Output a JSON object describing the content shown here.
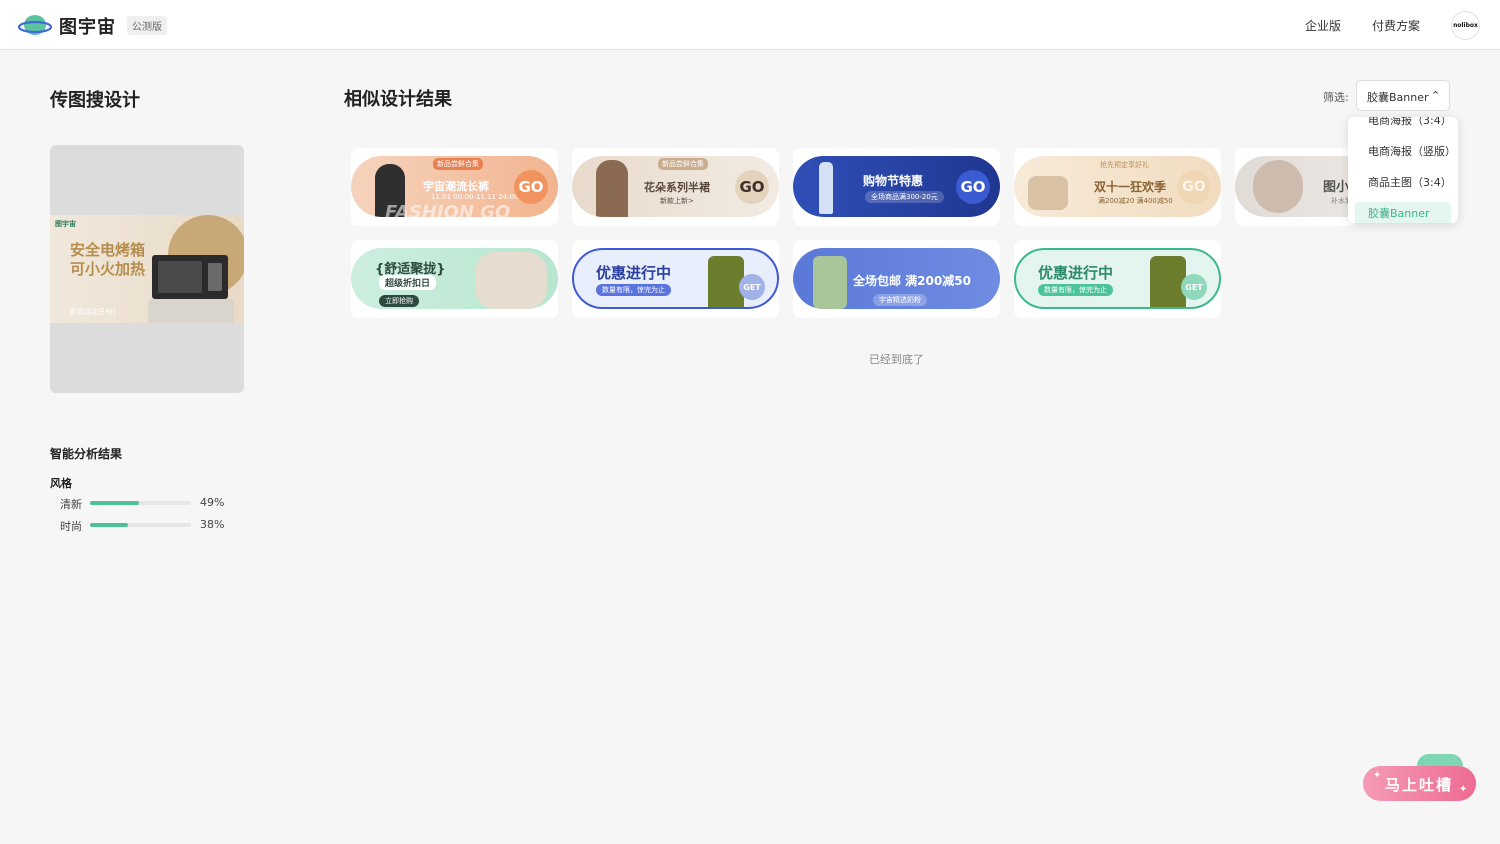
{
  "header": {
    "brand": "图宇宙",
    "beta_badge": "公测版",
    "nav": [
      "企业版",
      "付费方案"
    ],
    "avatar_text": "nolibox"
  },
  "left": {
    "title": "传图搜设计",
    "upload_preview": {
      "logo_text": "图宇宙",
      "line1": "安全电烤箱",
      "line2": "可小火加热",
      "footer": "新品活动日9行"
    },
    "analysis": {
      "title": "智能分析结果",
      "style_label": "风格",
      "styles": [
        {
          "label": "清新",
          "percent": 49,
          "percent_text": "49%"
        },
        {
          "label": "时尚",
          "percent": 38,
          "percent_text": "38%"
        }
      ]
    }
  },
  "main": {
    "title": "相似设计结果",
    "filter": {
      "label": "筛选:",
      "selected": "胶囊Banner",
      "options": [
        "电商海报（3:4）",
        "电商海报（竖版）",
        "商品主图（3:4）",
        "胶囊Banner"
      ]
    },
    "results": [
      {
        "title": "宇宙潮流长裤",
        "tag": "新品尝鲜合集",
        "sub": "11.01 00:00-11.11 24:00",
        "big": "FASHION GO",
        "cta": "GO",
        "bg": "#f3c6a8",
        "fg": "#ffffff",
        "go_bg": "#f0935e",
        "go_fg": "#ffffff"
      },
      {
        "title": "花朵系列半裙",
        "tag": "新品尝鲜合集",
        "sub": "新款上新>",
        "cta": "GO",
        "bg": "#efe4d8",
        "fg": "#5a4a3e",
        "go_bg": "#e4d2bc",
        "go_fg": "#3b2f26"
      },
      {
        "title": "购物节特惠",
        "sub": "全场商品满300-20元",
        "cta": "GO",
        "bg": "#2c46a8",
        "fg": "#ffffff",
        "go_bg": "#3a5bd1",
        "go_fg": "#ffffff"
      },
      {
        "title": "双十一狂欢季",
        "tag": "抢先预定享好礼",
        "sub": "满200减20 满400减50",
        "cta": "GO",
        "bg": "#f4e3cc",
        "fg": "#8a6232",
        "go_bg": "#efd6b4",
        "go_fg": "#fff6ea"
      },
      {
        "title": "图小",
        "sub": "补水乳",
        "bg": "#ece8e4",
        "fg": "#555555"
      },
      {
        "title": "{舒适聚拢}",
        "sub": "超级折扣日",
        "btn": "立即抢购",
        "bg": "#cdeedf",
        "fg": "#2d4a3e"
      },
      {
        "title": "优惠进行中",
        "sub": "数量有限，惊完为止",
        "cta": "GET",
        "bg": "#e9eefc",
        "fg": "#2a3f9e",
        "go_bg": "#a0b2e8",
        "go_fg": "#ffffff"
      },
      {
        "title": "全场包邮 满200减50",
        "sub": "宇宙精选奶粉",
        "bg": "#5a79d8",
        "fg": "#ffffff"
      },
      {
        "title": "优惠进行中",
        "sub": "数量有限，惊完为止",
        "cta": "GET",
        "bg": "#e3f5ee",
        "fg": "#2c8a68",
        "go_bg": "#8fd8bb",
        "go_fg": "#ffffff"
      }
    ],
    "bottom_note": "已经到底了"
  },
  "feedback": {
    "label": "马上吐槽"
  },
  "colors": {
    "accent": "#4fc19a",
    "feedback": "#ee6b93"
  }
}
